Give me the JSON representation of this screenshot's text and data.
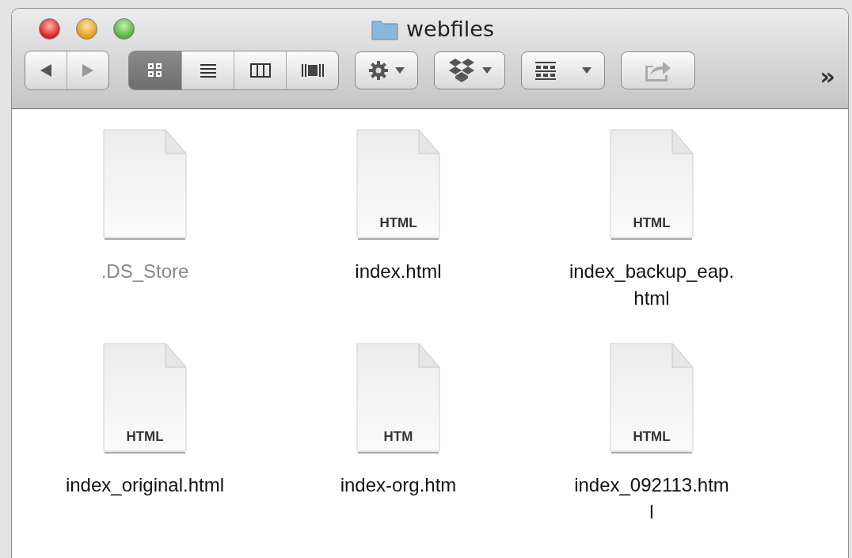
{
  "window": {
    "title": "webfiles"
  },
  "toolbar": {
    "view_modes": [
      {
        "kind": "icons",
        "selected": true
      },
      {
        "kind": "list",
        "selected": false
      },
      {
        "kind": "columns",
        "selected": false
      },
      {
        "kind": "coverflow",
        "selected": false
      }
    ],
    "overflow": "»"
  },
  "files": [
    {
      "lines": [
        ".DS_Store"
      ],
      "hidden": true
    },
    {
      "lines": [
        "index.html"
      ],
      "badge": "HTML",
      "hidden": false
    },
    {
      "lines": [
        "index_backup_eap.",
        "html"
      ],
      "badge": "HTML",
      "hidden": false
    },
    {
      "lines": [
        "index_original.html"
      ],
      "badge": "HTML",
      "hidden": false
    },
    {
      "lines": [
        "index-org.htm"
      ],
      "badge": "HTM",
      "hidden": false
    },
    {
      "lines": [
        "index_092113.htm",
        "l"
      ],
      "badge": "HTML",
      "hidden": false
    }
  ]
}
